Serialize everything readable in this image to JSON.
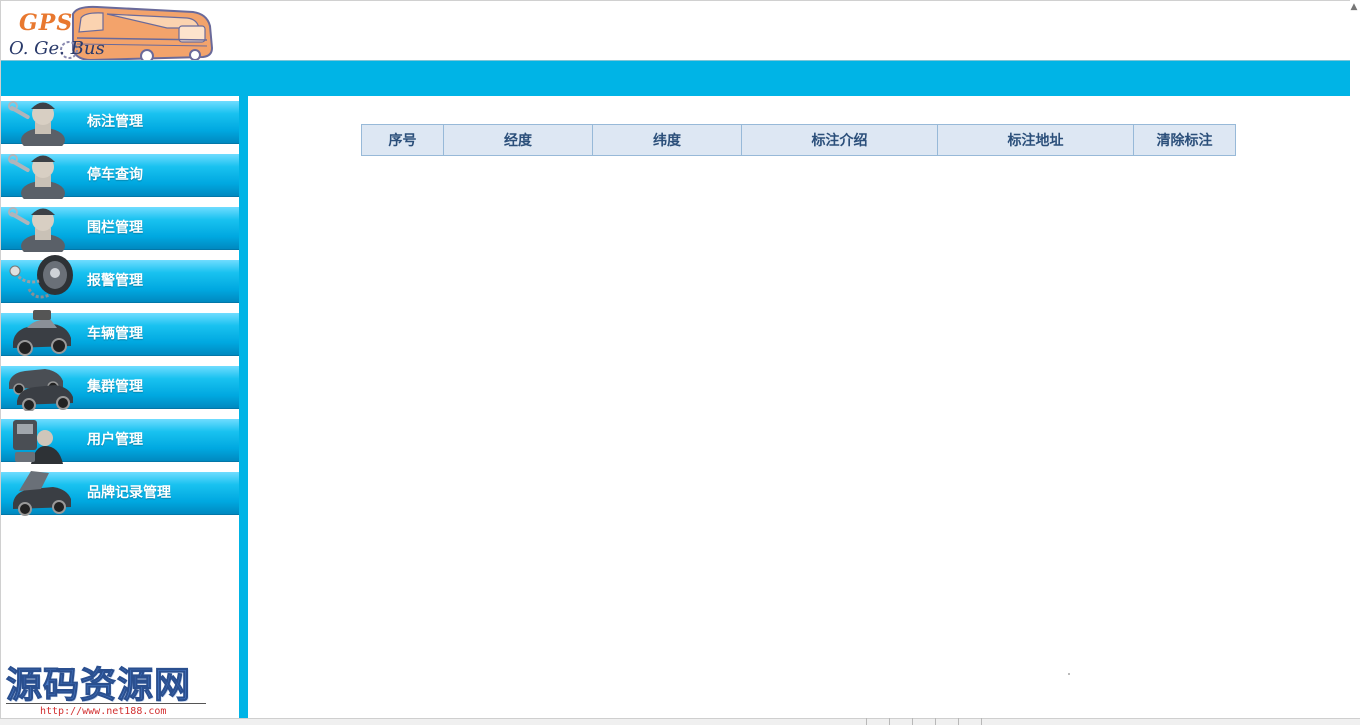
{
  "header": {
    "logo_gps": "GPS",
    "logo_bus": "O. Ge. Bus"
  },
  "sidebar": {
    "items": [
      {
        "label": "标注管理",
        "icon": "mechanic-icon"
      },
      {
        "label": "停车查询",
        "icon": "mechanic-icon"
      },
      {
        "label": "围栏管理",
        "icon": "mechanic-icon"
      },
      {
        "label": "报警管理",
        "icon": "alarm-remote-icon"
      },
      {
        "label": "车辆管理",
        "icon": "car-icon"
      },
      {
        "label": "集群管理",
        "icon": "cars-group-icon"
      },
      {
        "label": "用户管理",
        "icon": "user-device-icon"
      },
      {
        "label": "品牌记录管理",
        "icon": "car-open-hood-icon"
      }
    ]
  },
  "table": {
    "columns": [
      "序号",
      "经度",
      "纬度",
      "标注介绍",
      "标注地址",
      "清除标注"
    ]
  },
  "watermark": {
    "title": "源码资源网",
    "url": "http://www.net188.com"
  },
  "colors": {
    "accent": "#00b4e6",
    "table_header_bg": "#dde7f3",
    "table_border": "#97b9d8",
    "table_text": "#2b4f7a"
  }
}
